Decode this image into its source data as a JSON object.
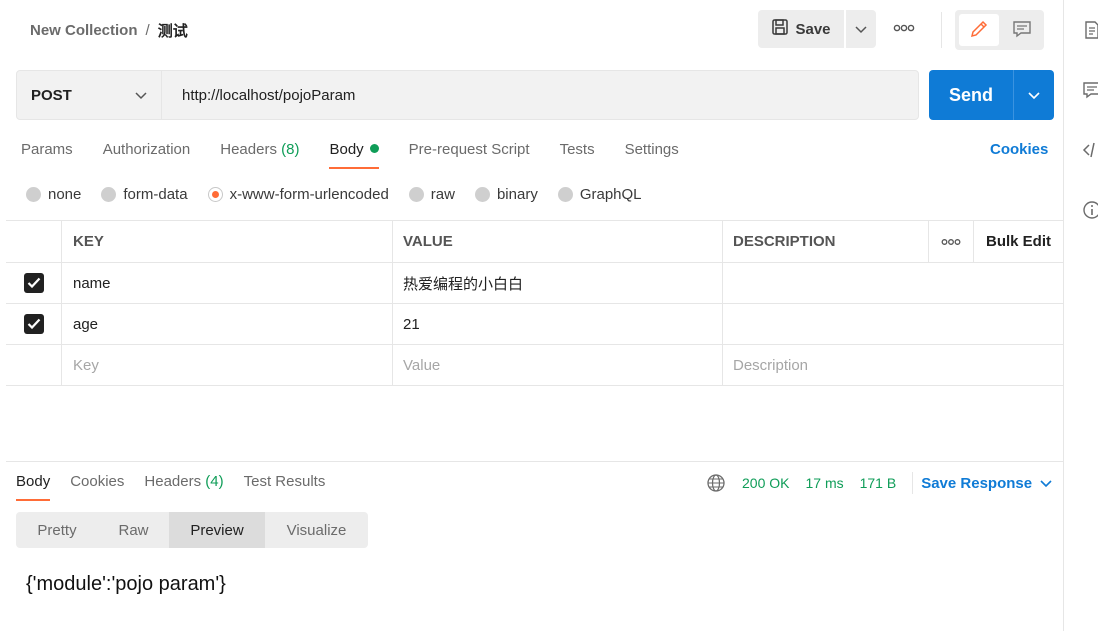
{
  "header": {
    "collection": "New Collection",
    "separator": "/",
    "request_name": "测试",
    "save_label": "Save",
    "more_label": "ooo"
  },
  "request": {
    "method": "POST",
    "url": "http://localhost/pojoParam",
    "send_label": "Send"
  },
  "tabs": [
    {
      "label": "Params"
    },
    {
      "label": "Authorization"
    },
    {
      "label": "Headers",
      "count": "(8)"
    },
    {
      "label": "Body",
      "active": true
    },
    {
      "label": "Pre-request Script"
    },
    {
      "label": "Tests"
    },
    {
      "label": "Settings"
    }
  ],
  "cookies_label": "Cookies",
  "body_types": [
    "none",
    "form-data",
    "x-www-form-urlencoded",
    "raw",
    "binary",
    "GraphQL"
  ],
  "body_type_selected": "x-www-form-urlencoded",
  "table": {
    "headers": {
      "key": "KEY",
      "value": "VALUE",
      "description": "DESCRIPTION",
      "more": "ooo",
      "bulk": "Bulk Edit"
    },
    "rows": [
      {
        "checked": true,
        "key": "name",
        "value": "热爱编程的小白白",
        "description": ""
      },
      {
        "checked": true,
        "key": "age",
        "value": "21",
        "description": ""
      }
    ],
    "placeholder": {
      "key": "Key",
      "value": "Value",
      "description": "Description"
    }
  },
  "response": {
    "tabs": [
      {
        "label": "Body",
        "active": true
      },
      {
        "label": "Cookies"
      },
      {
        "label": "Headers",
        "count": "(4)"
      },
      {
        "label": "Test Results"
      }
    ],
    "status": "200 OK",
    "time": "17 ms",
    "size": "171 B",
    "save_label": "Save Response",
    "view_tabs": [
      "Pretty",
      "Raw",
      "Preview",
      "Visualize"
    ],
    "view_selected": "Preview",
    "body": "{'module':'pojo param'}"
  },
  "colors": {
    "accent": "#ff6c37",
    "primary": "#0f7bd6",
    "success": "#0f9d58"
  }
}
